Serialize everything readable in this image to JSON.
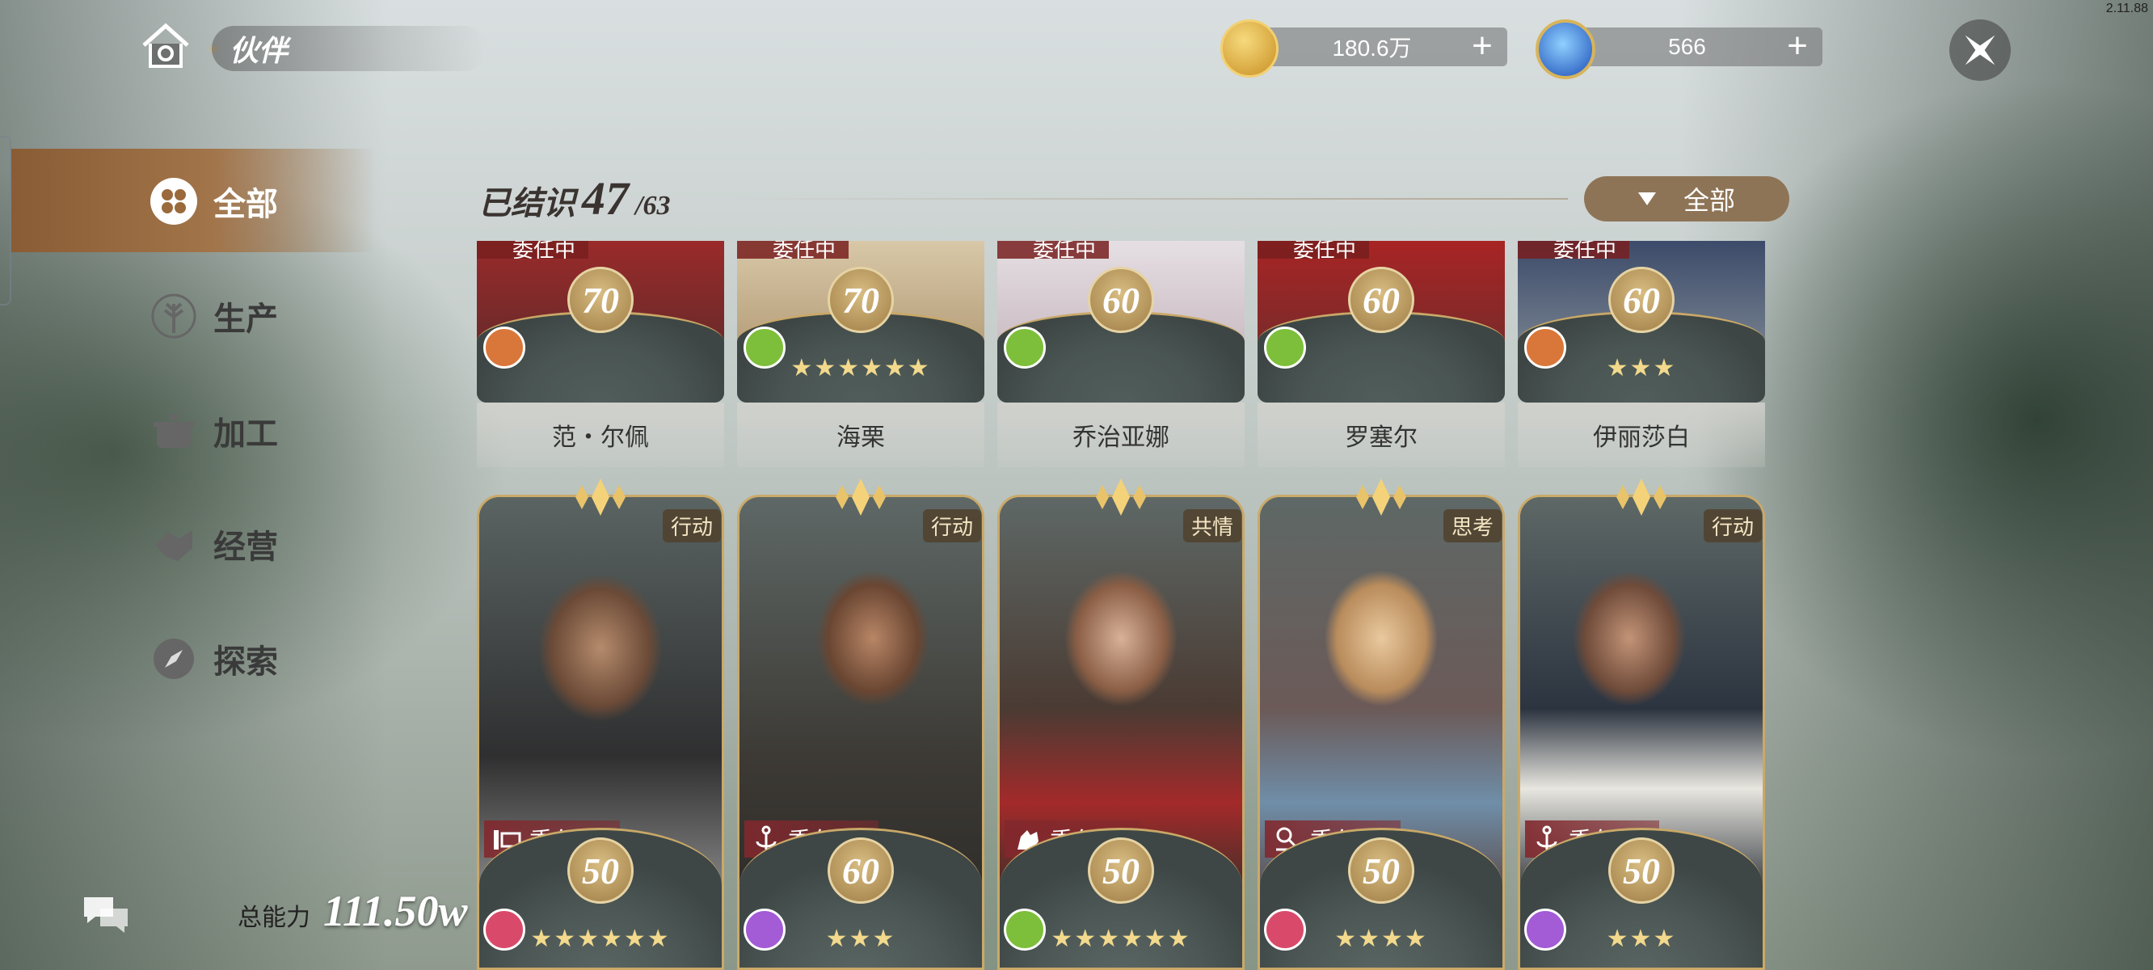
{
  "version": "2.11.88",
  "header": {
    "title": "伙伴"
  },
  "currencies": [
    {
      "icon": "gold-coin-icon",
      "value": "180.6万",
      "color": "#e0b44a"
    },
    {
      "icon": "blue-gem-icon",
      "value": "566",
      "color": "#3b7fe0"
    }
  ],
  "sidebar": {
    "items": [
      {
        "label": "全部",
        "icon": "all-grid-icon",
        "active": true
      },
      {
        "label": "生产",
        "icon": "wheat-icon"
      },
      {
        "label": "加工",
        "icon": "pot-icon"
      },
      {
        "label": "经营",
        "icon": "handshake-icon"
      },
      {
        "label": "探索",
        "icon": "compass-icon"
      }
    ]
  },
  "summary": {
    "label": "已结识",
    "count": "47",
    "total": "/63"
  },
  "filter": {
    "label": "全部"
  },
  "top_row": [
    {
      "name": "范・尔佩",
      "level": "70",
      "badge": "委任中",
      "stars": "",
      "role_color": "#d9773a"
    },
    {
      "name": "海栗",
      "level": "70",
      "badge": "委任中",
      "stars": "★★★★★★",
      "role_color": "#7dbf3a"
    },
    {
      "name": "乔治亚娜",
      "level": "60",
      "badge": "委任中",
      "stars": "",
      "role_color": "#7dbf3a"
    },
    {
      "name": "罗塞尔",
      "level": "60",
      "badge": "委任中",
      "stars": "",
      "role_color": "#7dbf3a"
    },
    {
      "name": "伊丽莎白",
      "level": "60",
      "badge": "委任中",
      "stars": "★★★",
      "role_color": "#d9773a"
    }
  ],
  "bottom_row": [
    {
      "trait": "行动",
      "level": "50",
      "assign": "委任中",
      "stars": "★★★★★★",
      "role_color": "#d94a6a"
    },
    {
      "trait": "行动",
      "level": "60",
      "assign": "委任中",
      "stars": "★★★",
      "role_color": "#a35bd6"
    },
    {
      "trait": "共情",
      "level": "50",
      "assign": "委任中",
      "stars": "★★★★★★",
      "role_color": "#7dbf3a"
    },
    {
      "trait": "思考",
      "level": "50",
      "assign": "委任中",
      "stars": "★★★★",
      "role_color": "#d94a6a"
    },
    {
      "trait": "行动",
      "level": "50",
      "assign": "委任中",
      "stars": "★★★",
      "role_color": "#a35bd6"
    }
  ],
  "power": {
    "label": "总能力",
    "value": "111.50w"
  }
}
